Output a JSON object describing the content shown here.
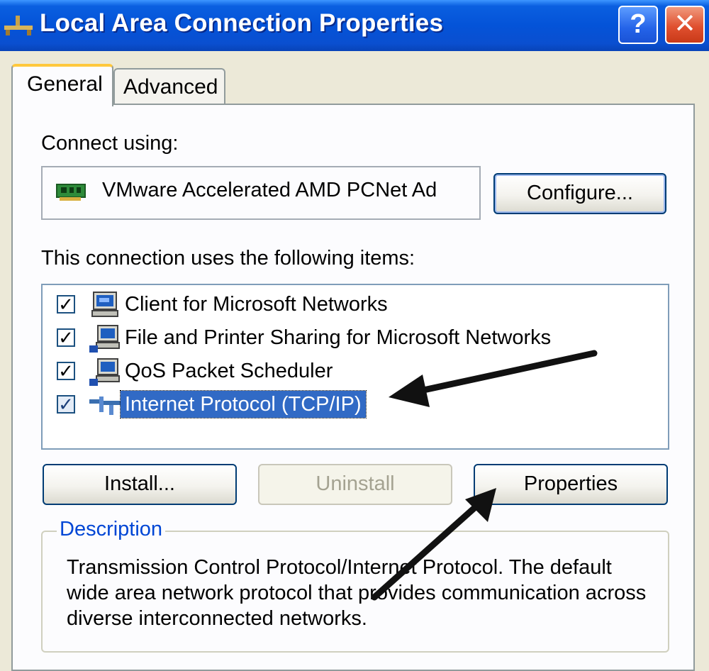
{
  "window": {
    "title": "Local Area Connection Properties",
    "help_label": "?",
    "close_label": "✕"
  },
  "tabs": [
    {
      "label": "General",
      "active": true
    },
    {
      "label": "Advanced",
      "active": false
    }
  ],
  "connect_using": {
    "label": "Connect using:",
    "adapter_name": "VMware Accelerated AMD PCNet Ad",
    "adapter_icon": "network-card-icon",
    "configure_label": "Configure..."
  },
  "items_section": {
    "label": "This connection uses the following items:",
    "items": [
      {
        "label": "Client for Microsoft Networks",
        "checked": true,
        "selected": false,
        "icon": "network-client-icon"
      },
      {
        "label": "File and Printer Sharing for Microsoft Networks",
        "checked": true,
        "selected": false,
        "icon": "network-service-icon"
      },
      {
        "label": "QoS Packet Scheduler",
        "checked": true,
        "selected": false,
        "icon": "network-service-icon"
      },
      {
        "label": "Internet Protocol (TCP/IP)",
        "checked": true,
        "selected": true,
        "icon": "network-protocol-icon"
      }
    ]
  },
  "buttons": {
    "install_label": "Install...",
    "uninstall_label": "Uninstall",
    "properties_label": "Properties"
  },
  "description": {
    "legend": "Description",
    "text": "Transmission Control Protocol/Internet Protocol. The default wide area network protocol that provides communication across diverse interconnected networks."
  },
  "colors": {
    "title_bar": "#0453d8",
    "selection": "#316ac5",
    "legend_text": "#0046d5",
    "close_button": "#e0502f"
  }
}
